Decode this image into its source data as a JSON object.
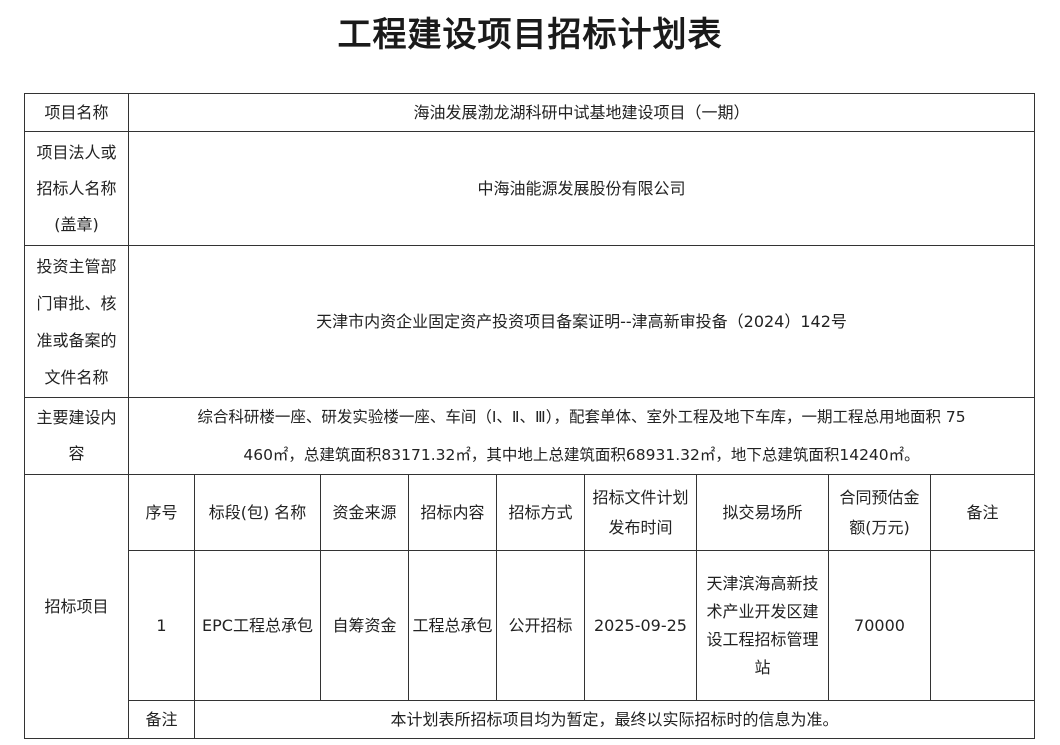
{
  "title": "工程建设项目招标计划表",
  "rows": {
    "project_name": {
      "label": "项目名称",
      "value": "海油发展渤龙湖科研中试基地建设项目（一期）"
    },
    "legal_person": {
      "label_lines": [
        "项目法人或",
        "招标人名称",
        "(盖章)"
      ],
      "value": "中海油能源发展股份有限公司"
    },
    "approval_doc": {
      "label_lines": [
        "投资主管部",
        "门审批、核",
        "准或备案的",
        "文件名称"
      ],
      "value": "天津市内资企业固定资产投资项目备案证明--津高新审投备（2024）142号"
    },
    "main_content": {
      "label_lines": [
        "主要建设内",
        "容"
      ],
      "value_lines": [
        "综合科研楼一座、研发实验楼一座、车间（Ⅰ、Ⅱ、Ⅲ），配套单体、室外工程及地下车库，一期工程总用地面积 75",
        "460㎡，总建筑面积83171.32㎡，其中地上总建筑面积68931.32㎡，地下总建筑面积14240㎡。"
      ]
    }
  },
  "tender_section": {
    "label": "招标项目",
    "headers": {
      "seq": "序号",
      "section": "标段(包) 名称",
      "fund": "资金来源",
      "content": "招标内容",
      "method": "招标方式",
      "time_lines": [
        "招标文件计划",
        "发布时间"
      ],
      "venue": "拟交易场所",
      "amount_lines": [
        "合同预估金",
        "额(万元)"
      ],
      "remark": "备注"
    },
    "item": {
      "seq": "1",
      "section": "EPC工程总承包",
      "fund": "自筹资金",
      "content": "工程总承包",
      "method": "公开招标",
      "time": "2025-09-25",
      "venue_lines": [
        "天津滨海高新技",
        "术产业开发区建",
        "设工程招标管理",
        "站"
      ],
      "amount": "70000",
      "remark": ""
    },
    "note": {
      "label": "备注",
      "value": "本计划表所招标项目均为暂定，最终以实际招标时的信息为准。"
    }
  }
}
